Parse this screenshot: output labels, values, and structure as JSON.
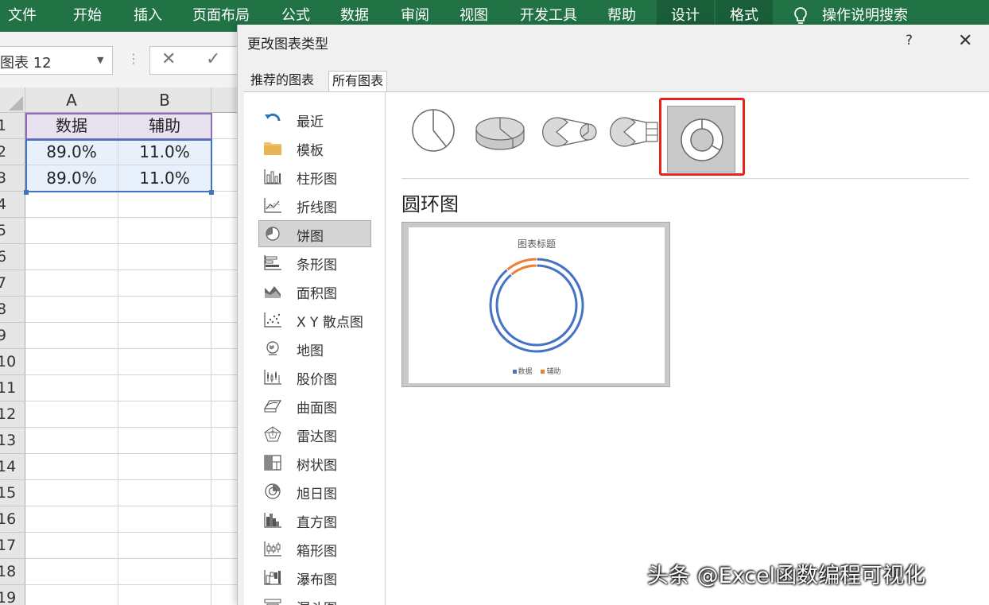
{
  "ribbon": {
    "tabs": [
      "文件",
      "开始",
      "插入",
      "页面布局",
      "公式",
      "数据",
      "审阅",
      "视图",
      "开发工具",
      "帮助",
      "设计",
      "格式"
    ],
    "search_label": "操作说明搜索",
    "bg_color": "#217346",
    "active_bg_color": "#1a5e39"
  },
  "formula_bar": {
    "name_box": "图表 12",
    "cancel_icon": "✕",
    "enter_icon": "✓"
  },
  "sheet": {
    "columns": [
      "A",
      "B"
    ],
    "rows": [
      "1",
      "2",
      "3",
      "4",
      "5",
      "6",
      "7",
      "8",
      "9",
      "10",
      "11",
      "12",
      "13",
      "14",
      "15",
      "16",
      "17",
      "18",
      "19"
    ],
    "cells": [
      [
        "数据",
        "辅助"
      ],
      [
        "89.0%",
        "11.0%"
      ],
      [
        "89.0%",
        "11.0%"
      ]
    ]
  },
  "dialog": {
    "title": "更改图表类型",
    "help": "?",
    "close": "✕",
    "tabs": [
      "推荐的图表",
      "所有图表"
    ],
    "active_tab": "所有图表",
    "chart_types": [
      {
        "label": "最近",
        "icon": "recent-icon"
      },
      {
        "label": "模板",
        "icon": "folder-icon"
      },
      {
        "label": "柱形图",
        "icon": "column-chart-icon"
      },
      {
        "label": "折线图",
        "icon": "line-chart-icon"
      },
      {
        "label": "饼图",
        "icon": "pie-chart-icon"
      },
      {
        "label": "条形图",
        "icon": "bar-chart-icon"
      },
      {
        "label": "面积图",
        "icon": "area-chart-icon"
      },
      {
        "label": "X Y 散点图",
        "icon": "scatter-chart-icon"
      },
      {
        "label": "地图",
        "icon": "map-chart-icon"
      },
      {
        "label": "股价图",
        "icon": "stock-chart-icon"
      },
      {
        "label": "曲面图",
        "icon": "surface-chart-icon"
      },
      {
        "label": "雷达图",
        "icon": "radar-chart-icon"
      },
      {
        "label": "树状图",
        "icon": "treemap-chart-icon"
      },
      {
        "label": "旭日图",
        "icon": "sunburst-chart-icon"
      },
      {
        "label": "直方图",
        "icon": "histogram-chart-icon"
      },
      {
        "label": "箱形图",
        "icon": "box-chart-icon"
      },
      {
        "label": "瀑布图",
        "icon": "waterfall-chart-icon"
      },
      {
        "label": "漏斗图",
        "icon": "funnel-chart-icon"
      }
    ],
    "selected_type": "饼图",
    "subtypes": [
      "pie-icon",
      "3d-pie-icon",
      "pie-of-pie-icon",
      "bar-of-pie-icon",
      "doughnut-icon"
    ],
    "selected_subtype": "doughnut-icon",
    "subtype_title": "圆环图",
    "highlight_color": "#e8231b",
    "preview": {
      "title": "图表标题",
      "colors": {
        "数据": "#4472c4",
        "辅助": "#ed7d31"
      }
    }
  },
  "chart_data": {
    "type": "pie",
    "title": "图表标题",
    "categories": [
      "数据",
      "辅助"
    ],
    "series": [
      {
        "values": [
          0.89,
          0.11
        ]
      },
      {
        "values": [
          0.89,
          0.11
        ]
      }
    ],
    "legend": "bottom"
  },
  "watermark": "头条 @Excel函数编程可视化"
}
